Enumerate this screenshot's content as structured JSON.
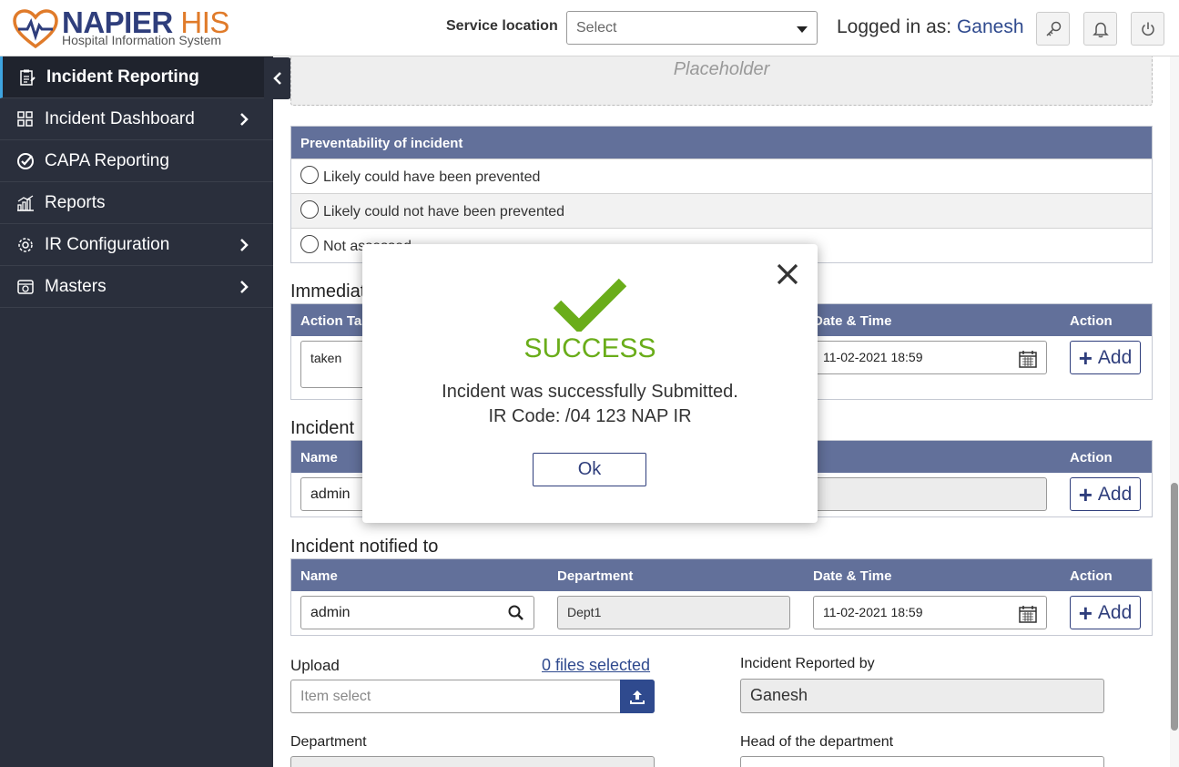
{
  "header": {
    "logo_main": "NAPIER",
    "logo_his": "HIS",
    "logo_sub": "Hospital Information System",
    "service_location_label": "Service location",
    "service_location_value": "Select",
    "logged_in_label": "Logged in as:",
    "user": "Ganesh",
    "icons": [
      "key-icon",
      "bell-icon",
      "power-icon"
    ]
  },
  "sidebar": {
    "items": [
      {
        "label": "Incident Reporting",
        "icon": "clipboard-icon",
        "active": true
      },
      {
        "label": "Incident Dashboard",
        "icon": "grid-icon",
        "chevron": true
      },
      {
        "label": "CAPA Reporting",
        "icon": "check-circle-icon"
      },
      {
        "label": "Reports",
        "icon": "chart-icon"
      },
      {
        "label": "IR Configuration",
        "icon": "settings-icon",
        "chevron": true
      },
      {
        "label": "Masters",
        "icon": "database-icon",
        "chevron": true
      }
    ]
  },
  "main": {
    "placeholder": "Placeholder",
    "preventability": {
      "header": "Preventability of incident",
      "options": [
        "Likely could have been prevented",
        "Likely could not have been prevented",
        "Not assessed"
      ]
    },
    "immediate": {
      "title": "Immediate",
      "col_action_taken": "Action Ta",
      "col_datetime": "Date & Time",
      "col_action": "Action",
      "action_value": "taken",
      "datetime_value": "11-02-2021 18:59",
      "add_label": "Add"
    },
    "incident_sec": {
      "title": "Incident",
      "col_name": "Name",
      "col_action": "Action",
      "name_value": "admin",
      "add_label": "Add"
    },
    "notified": {
      "title": "Incident notified to",
      "col_name": "Name",
      "col_department": "Department",
      "col_datetime": "Date & Time",
      "col_action": "Action",
      "name_value": "admin",
      "department_value": "Dept1",
      "datetime_value": "11-02-2021 18:59",
      "add_label": "Add"
    },
    "upload": {
      "label": "Upload",
      "files_link": "0 files selected",
      "placeholder": "Item select"
    },
    "reported_by": {
      "label": "Incident Reported by",
      "value": "Ganesh"
    },
    "department": {
      "label": "Department"
    },
    "head_of_department": {
      "label": "Head of the department"
    }
  },
  "modal": {
    "title": "SUCCESS",
    "message": "Incident was successfully Submitted.",
    "ir_code": "IR Code: /04 123 NAP IR",
    "ok_label": "Ok"
  },
  "colors": {
    "sidebar_bg": "#2a2f3c",
    "table_header": "#62709a",
    "brand_blue": "#2f3e7c",
    "success_green": "#6aad1a",
    "accent_orange": "#e07b2a"
  }
}
